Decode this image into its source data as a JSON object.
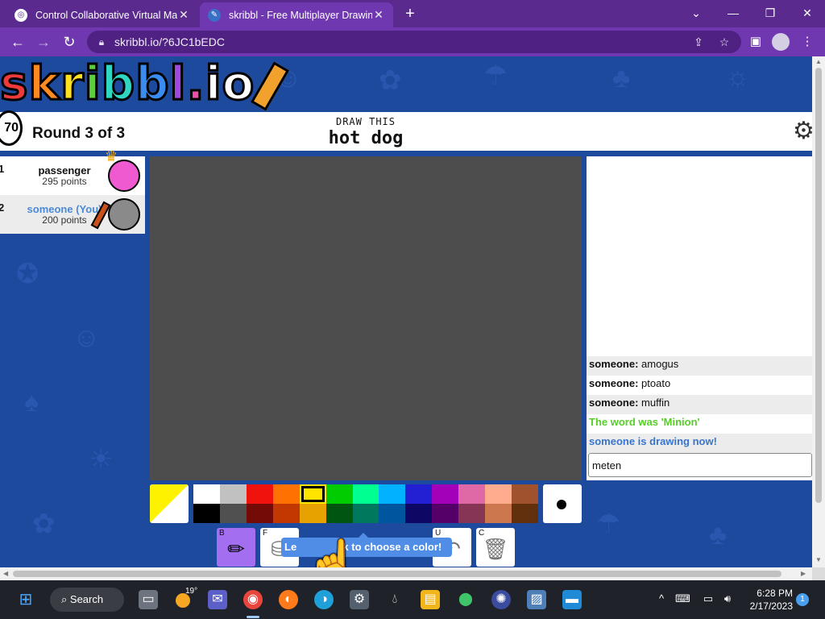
{
  "browser": {
    "tabs": [
      {
        "title": "Control Collaborative Virtual Mac",
        "active": false
      },
      {
        "title": "skribbl - Free Multiplayer Drawin",
        "active": true
      }
    ],
    "new_tab_symbol": "+",
    "window_controls": [
      "chevron-down",
      "minimize",
      "restore",
      "close"
    ],
    "url": "skribbl.io/?6JC1bEDC"
  },
  "game": {
    "logo_letters": [
      {
        "ch": "s",
        "color": "#ef3a3a"
      },
      {
        "ch": "k",
        "color": "#ff8a1f"
      },
      {
        "ch": "r",
        "color": "#ffe21f"
      },
      {
        "ch": "i",
        "color": "#5ad13a"
      },
      {
        "ch": "b",
        "color": "#2fd6c2"
      },
      {
        "ch": "b",
        "color": "#3b8cf0"
      },
      {
        "ch": "l",
        "color": "#a148e0"
      },
      {
        "ch": ".",
        "color": "#ef4fa8"
      },
      {
        "ch": "i",
        "color": "#ffffff"
      },
      {
        "ch": "o",
        "color": "#ffffff"
      }
    ],
    "timer": "70",
    "round": "Round 3 of 3",
    "draw_label": "DRAW THIS",
    "word": "hot dog",
    "players": [
      {
        "rank": "1",
        "name": "passenger",
        "points": "295 points",
        "avatar_color": "#f05ad1",
        "is_owner": true,
        "is_drawing": false
      },
      {
        "rank": "2",
        "name": "someone (You)",
        "points": "200 points",
        "avatar_color": "#8a8a8a",
        "is_owner": false,
        "is_drawing": true
      }
    ],
    "chat": [
      {
        "author": "someone:",
        "text": "amogus",
        "style": "alt"
      },
      {
        "author": "someone:",
        "text": "ptoato",
        "style": "normal"
      },
      {
        "author": "someone:",
        "text": "muffin",
        "style": "alt"
      },
      {
        "author": "",
        "text": "The word was 'Minion'",
        "style": "green"
      },
      {
        "author": "",
        "text": "someone is drawing now!",
        "style": "blue"
      }
    ],
    "chat_input_value": "meten",
    "palette": [
      "#ffffff",
      "#c1c1c1",
      "#ef130b",
      "#ff7100",
      "#ffe400",
      "#00cc00",
      "#00ff91",
      "#00b2ff",
      "#231fd3",
      "#a300ba",
      "#df69a7",
      "#ffac8e",
      "#a0522d",
      "#000000",
      "#505050",
      "#740b07",
      "#c23800",
      "#e8a200",
      "#005510",
      "#00785d",
      "#00569e",
      "#0e0865",
      "#550069",
      "#873554",
      "#cc774d",
      "#63300d"
    ],
    "selected_swatch_index": 4,
    "tools": [
      {
        "key": "B",
        "icon": "pencil-icon",
        "selected": true
      },
      {
        "key": "F",
        "icon": "fill-icon",
        "selected": false
      },
      {
        "key": "U",
        "icon": "undo-icon",
        "selected": false
      },
      {
        "key": "C",
        "icon": "trash-icon",
        "selected": false
      }
    ],
    "tooltip": "Left click to choose a color!",
    "tooltip_visible_left": "Le",
    "tooltip_visible_right": "ck to choose a color!"
  },
  "taskbar": {
    "search_label": "Search",
    "weather_temp": "19°",
    "time": "6:28 PM",
    "date": "2/17/2023",
    "notification_count": "1"
  }
}
